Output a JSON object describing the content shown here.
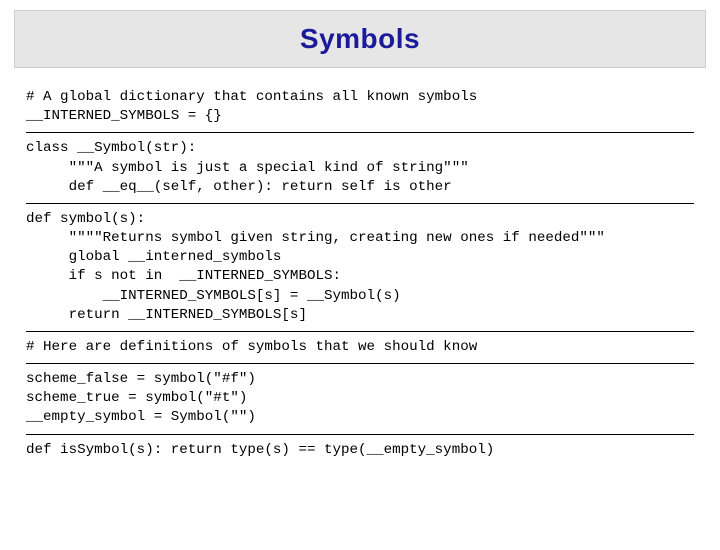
{
  "title": "Symbols",
  "code": {
    "block1": "# A global dictionary that contains all known symbols\n__INTERNED_SYMBOLS = {}",
    "block2": "class __Symbol(str):\n     \"\"\"A symbol is just a special kind of string\"\"\"\n     def __eq__(self, other): return self is other",
    "block3": "def symbol(s):\n     \"\"\"\"Returns symbol given string, creating new ones if needed\"\"\"\n     global __interned_symbols\n     if s not in  __INTERNED_SYMBOLS:\n         __INTERNED_SYMBOLS[s] = __Symbol(s)\n     return __INTERNED_SYMBOLS[s]",
    "block4": "# Here are definitions of symbols that we should know",
    "block5": "scheme_false = symbol(\"#f\")\nscheme_true = symbol(\"#t\")\n__empty_symbol = Symbol(\"\")",
    "block6": "def isSymbol(s): return type(s) == type(__empty_symbol)"
  }
}
